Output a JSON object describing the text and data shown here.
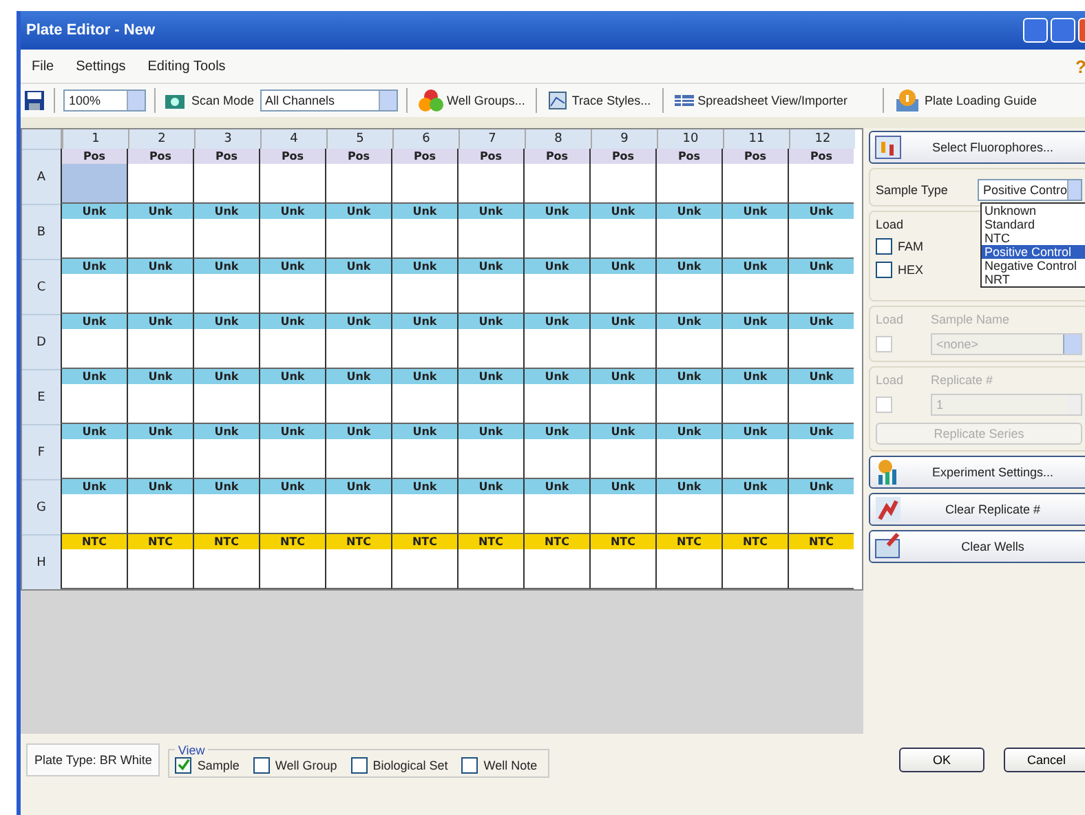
{
  "window": {
    "title": "Plate Editor - New"
  },
  "menu": [
    "File",
    "Settings",
    "Editing Tools"
  ],
  "help": "?",
  "toolbar": {
    "zoom": "100%",
    "scan_mode_label": "Scan Mode",
    "scan_mode": "All Channels",
    "well_groups": "Well Groups...",
    "trace_styles": "Trace Styles...",
    "spreadsheet": "Spreadsheet View/Importer",
    "guide": "Plate Loading Guide"
  },
  "plate": {
    "columns": [
      "1",
      "2",
      "3",
      "4",
      "5",
      "6",
      "7",
      "8",
      "9",
      "10",
      "11",
      "12"
    ],
    "rows": [
      {
        "label": "A",
        "wells": [
          {
            "text": "Pos",
            "kind": "pos",
            "selected": true
          },
          {
            "text": "Pos",
            "kind": "pos",
            "selected": false
          },
          {
            "text": "Pos",
            "kind": "pos",
            "selected": false
          },
          {
            "text": "Pos",
            "kind": "pos",
            "selected": false
          },
          {
            "text": "Pos",
            "kind": "pos",
            "selected": false
          },
          {
            "text": "Pos",
            "kind": "pos",
            "selected": false
          },
          {
            "text": "Pos",
            "kind": "pos",
            "selected": false
          },
          {
            "text": "Pos",
            "kind": "pos",
            "selected": false
          },
          {
            "text": "Pos",
            "kind": "pos",
            "selected": false
          },
          {
            "text": "Pos",
            "kind": "pos",
            "selected": false
          },
          {
            "text": "Pos",
            "kind": "pos",
            "selected": false
          },
          {
            "text": "Pos",
            "kind": "pos",
            "selected": false
          }
        ]
      },
      {
        "label": "B",
        "wells": [
          {
            "text": "Unk",
            "kind": "unk",
            "selected": false
          },
          {
            "text": "Unk",
            "kind": "unk",
            "selected": false
          },
          {
            "text": "Unk",
            "kind": "unk",
            "selected": false
          },
          {
            "text": "Unk",
            "kind": "unk",
            "selected": false
          },
          {
            "text": "Unk",
            "kind": "unk",
            "selected": false
          },
          {
            "text": "Unk",
            "kind": "unk",
            "selected": false
          },
          {
            "text": "Unk",
            "kind": "unk",
            "selected": false
          },
          {
            "text": "Unk",
            "kind": "unk",
            "selected": false
          },
          {
            "text": "Unk",
            "kind": "unk",
            "selected": false
          },
          {
            "text": "Unk",
            "kind": "unk",
            "selected": false
          },
          {
            "text": "Unk",
            "kind": "unk",
            "selected": false
          },
          {
            "text": "Unk",
            "kind": "unk",
            "selected": false
          }
        ]
      },
      {
        "label": "C",
        "wells": [
          {
            "text": "Unk",
            "kind": "unk",
            "selected": false
          },
          {
            "text": "Unk",
            "kind": "unk",
            "selected": false
          },
          {
            "text": "Unk",
            "kind": "unk",
            "selected": false
          },
          {
            "text": "Unk",
            "kind": "unk",
            "selected": false
          },
          {
            "text": "Unk",
            "kind": "unk",
            "selected": false
          },
          {
            "text": "Unk",
            "kind": "unk",
            "selected": false
          },
          {
            "text": "Unk",
            "kind": "unk",
            "selected": false
          },
          {
            "text": "Unk",
            "kind": "unk",
            "selected": false
          },
          {
            "text": "Unk",
            "kind": "unk",
            "selected": false
          },
          {
            "text": "Unk",
            "kind": "unk",
            "selected": false
          },
          {
            "text": "Unk",
            "kind": "unk",
            "selected": false
          },
          {
            "text": "Unk",
            "kind": "unk",
            "selected": false
          }
        ]
      },
      {
        "label": "D",
        "wells": [
          {
            "text": "Unk",
            "kind": "unk",
            "selected": false
          },
          {
            "text": "Unk",
            "kind": "unk",
            "selected": false
          },
          {
            "text": "Unk",
            "kind": "unk",
            "selected": false
          },
          {
            "text": "Unk",
            "kind": "unk",
            "selected": false
          },
          {
            "text": "Unk",
            "kind": "unk",
            "selected": false
          },
          {
            "text": "Unk",
            "kind": "unk",
            "selected": false
          },
          {
            "text": "Unk",
            "kind": "unk",
            "selected": false
          },
          {
            "text": "Unk",
            "kind": "unk",
            "selected": false
          },
          {
            "text": "Unk",
            "kind": "unk",
            "selected": false
          },
          {
            "text": "Unk",
            "kind": "unk",
            "selected": false
          },
          {
            "text": "Unk",
            "kind": "unk",
            "selected": false
          },
          {
            "text": "Unk",
            "kind": "unk",
            "selected": false
          }
        ]
      },
      {
        "label": "E",
        "wells": [
          {
            "text": "Unk",
            "kind": "unk",
            "selected": false
          },
          {
            "text": "Unk",
            "kind": "unk",
            "selected": false
          },
          {
            "text": "Unk",
            "kind": "unk",
            "selected": false
          },
          {
            "text": "Unk",
            "kind": "unk",
            "selected": false
          },
          {
            "text": "Unk",
            "kind": "unk",
            "selected": false
          },
          {
            "text": "Unk",
            "kind": "unk",
            "selected": false
          },
          {
            "text": "Unk",
            "kind": "unk",
            "selected": false
          },
          {
            "text": "Unk",
            "kind": "unk",
            "selected": false
          },
          {
            "text": "Unk",
            "kind": "unk",
            "selected": false
          },
          {
            "text": "Unk",
            "kind": "unk",
            "selected": false
          },
          {
            "text": "Unk",
            "kind": "unk",
            "selected": false
          },
          {
            "text": "Unk",
            "kind": "unk",
            "selected": false
          }
        ]
      },
      {
        "label": "F",
        "wells": [
          {
            "text": "Unk",
            "kind": "unk",
            "selected": false
          },
          {
            "text": "Unk",
            "kind": "unk",
            "selected": false
          },
          {
            "text": "Unk",
            "kind": "unk",
            "selected": false
          },
          {
            "text": "Unk",
            "kind": "unk",
            "selected": false
          },
          {
            "text": "Unk",
            "kind": "unk",
            "selected": false
          },
          {
            "text": "Unk",
            "kind": "unk",
            "selected": false
          },
          {
            "text": "Unk",
            "kind": "unk",
            "selected": false
          },
          {
            "text": "Unk",
            "kind": "unk",
            "selected": false
          },
          {
            "text": "Unk",
            "kind": "unk",
            "selected": false
          },
          {
            "text": "Unk",
            "kind": "unk",
            "selected": false
          },
          {
            "text": "Unk",
            "kind": "unk",
            "selected": false
          },
          {
            "text": "Unk",
            "kind": "unk",
            "selected": false
          }
        ]
      },
      {
        "label": "G",
        "wells": [
          {
            "text": "Unk",
            "kind": "unk",
            "selected": false
          },
          {
            "text": "Unk",
            "kind": "unk",
            "selected": false
          },
          {
            "text": "Unk",
            "kind": "unk",
            "selected": false
          },
          {
            "text": "Unk",
            "kind": "unk",
            "selected": false
          },
          {
            "text": "Unk",
            "kind": "unk",
            "selected": false
          },
          {
            "text": "Unk",
            "kind": "unk",
            "selected": false
          },
          {
            "text": "Unk",
            "kind": "unk",
            "selected": false
          },
          {
            "text": "Unk",
            "kind": "unk",
            "selected": false
          },
          {
            "text": "Unk",
            "kind": "unk",
            "selected": false
          },
          {
            "text": "Unk",
            "kind": "unk",
            "selected": false
          },
          {
            "text": "Unk",
            "kind": "unk",
            "selected": false
          },
          {
            "text": "Unk",
            "kind": "unk",
            "selected": false
          }
        ]
      },
      {
        "label": "H",
        "wells": [
          {
            "text": "NTC",
            "kind": "ntc",
            "selected": false
          },
          {
            "text": "NTC",
            "kind": "ntc",
            "selected": false
          },
          {
            "text": "NTC",
            "kind": "ntc",
            "selected": false
          },
          {
            "text": "NTC",
            "kind": "ntc",
            "selected": false
          },
          {
            "text": "NTC",
            "kind": "ntc",
            "selected": false
          },
          {
            "text": "NTC",
            "kind": "ntc",
            "selected": false
          },
          {
            "text": "NTC",
            "kind": "ntc",
            "selected": false
          },
          {
            "text": "NTC",
            "kind": "ntc",
            "selected": false
          },
          {
            "text": "NTC",
            "kind": "ntc",
            "selected": false
          },
          {
            "text": "NTC",
            "kind": "ntc",
            "selected": false
          },
          {
            "text": "NTC",
            "kind": "ntc",
            "selected": false
          },
          {
            "text": "NTC",
            "kind": "ntc",
            "selected": false
          }
        ]
      }
    ]
  },
  "panel": {
    "select_fluorophores": "Select Fluorophores...",
    "sample_type": {
      "label": "Sample Type",
      "value": "Positive Contro",
      "options": [
        {
          "label": "Unknown",
          "selected": false
        },
        {
          "label": "Standard",
          "selected": false
        },
        {
          "label": "NTC",
          "selected": false
        },
        {
          "label": "Positive Control",
          "selected": true
        },
        {
          "label": "Negative Control",
          "selected": false
        },
        {
          "label": "NRT",
          "selected": false
        }
      ]
    },
    "load_label": "Load",
    "fluorophores": [
      {
        "label": "FAM",
        "checked": false
      },
      {
        "label": "HEX",
        "checked": false
      }
    ],
    "sample_name": {
      "load_label": "Load",
      "load_checked": false,
      "label": "Sample Name",
      "value": "<none>",
      "disabled": true
    },
    "replicate": {
      "load_label": "Load",
      "load_checked": false,
      "label": "Replicate #",
      "value": "1",
      "disabled": true,
      "series_button": "Replicate Series"
    },
    "buttons": [
      "Experiment Settings...",
      "Clear Replicate #",
      "Clear Wells"
    ]
  },
  "footer": {
    "plate_type": "Plate Type: BR White",
    "view_label": "View",
    "view_options": [
      {
        "label": "Sample",
        "checked": true
      },
      {
        "label": "Well Group",
        "checked": false
      },
      {
        "label": "Biological Set",
        "checked": false
      },
      {
        "label": "Well Note",
        "checked": false
      }
    ],
    "ok": "OK",
    "cancel": "Cancel"
  }
}
